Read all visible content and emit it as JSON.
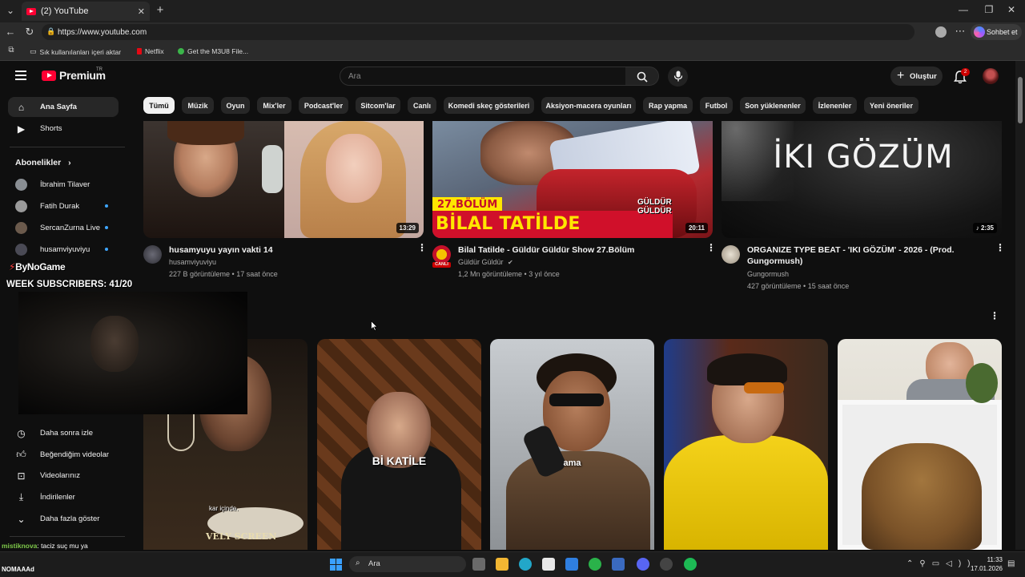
{
  "browser": {
    "tab_title": "(2) YouTube",
    "url": "https://www.youtube.com",
    "chat_button": "Sohbet et",
    "bookmarks": [
      "Sık kullanılanları içeri aktar",
      "Netflix",
      "Get the M3U8 File..."
    ]
  },
  "header": {
    "logo_text": "Premium",
    "logo_region": "TR",
    "search_placeholder": "Ara",
    "create_label": "Oluştur",
    "notification_count": "2"
  },
  "chips": [
    "Tümü",
    "Müzik",
    "Oyun",
    "Mix'ler",
    "Podcast'ler",
    "Sitcom'lar",
    "Canlı",
    "Komedi skeç gösterileri",
    "Aksiyon-macera oyunları",
    "Rap yapma",
    "Futbol",
    "Son yüklenenler",
    "İzlenenler",
    "Yeni öneriler"
  ],
  "sidebar": {
    "home": "Ana Sayfa",
    "shorts": "Shorts",
    "subscriptions_header": "Abonelikler",
    "subscriptions": [
      "İbrahim Tilaver",
      "Fatih Durak",
      "SercanZurna Live",
      "husamviyuviyu"
    ],
    "library": [
      "Daha sonra izle",
      "Beğendiğim videolar",
      "Videolarınız",
      "İndirilenler",
      "Daha fazla göster"
    ]
  },
  "videos": [
    {
      "title": "husamyuyu yayın vakti 14",
      "channel": "husamviyuviyu",
      "meta": "227 B görüntüleme • 17 saat önce",
      "duration": "13:29"
    },
    {
      "title": "Bilal Tatilde - Güldür Güldür Show 27.Bölüm",
      "channel": "Güldür Güldür",
      "meta": "1,2 Mn görüntüleme • 3 yıl önce",
      "duration": "20:11",
      "thumb_banner_top": "27.BÖLÜM",
      "thumb_banner_bottom": "BİLAL TATİLDE",
      "thumb_show": "GÜLDÜR GÜLDÜR",
      "channel_badge": "CANLI"
    },
    {
      "title": "ORGANIZE TYPE BEAT - 'IKI GÖZÜM' - 2026  - (Prod. Gungormush)",
      "channel": "Gungormush",
      "meta": "427 görüntüleme • 15 saat önce",
      "duration": "2:35",
      "thumb_text": "İKI GÖZÜM"
    }
  ],
  "shorts_captions": [
    "kar içinde.",
    "VELY SCREEN",
    "Bİ KATİLE",
    "ama"
  ],
  "stream_overlay": {
    "name": "ByNoGame",
    "goal": "WEEK SUBSCRIBERS: 41/20",
    "chat_user": "mistiknova",
    "chat_message": ": taciz suç mu ya",
    "bottom_tag": "NOMAAAd"
  },
  "taskbar": {
    "search_placeholder": "Ara",
    "time": "11:33",
    "date": "17.01.2026"
  },
  "colors": {
    "brand_red": "#ff0033",
    "background": "#0f0f0f",
    "chip_bg": "#272727",
    "banner_yellow": "#ffe600"
  }
}
